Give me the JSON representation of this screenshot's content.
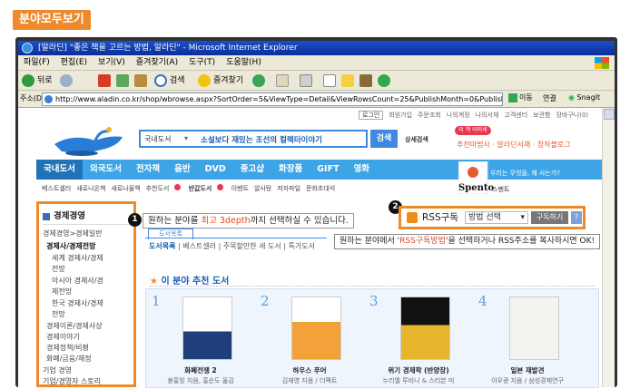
{
  "badge": "분야모두보기",
  "window": {
    "title": "[알라딘] \"좋은 책을 고르는 방법, 알라딘\" - Microsoft Internet Explorer"
  },
  "menubar": [
    "파일(F)",
    "편집(E)",
    "보기(V)",
    "즐겨찾기(A)",
    "도구(T)",
    "도움말(H)"
  ],
  "toolbar": {
    "back": "뒤로",
    "search": "검색",
    "favorites": "즐겨찾기"
  },
  "address": {
    "label": "주소(D)",
    "url": "http://www.aladin.co.kr/shop/wbrowse.aspx?SortOrder=5&ViewType=Detail&ViewRowsCount=25&PublishMonth=0&Publish",
    "go": "이동",
    "links": "연결",
    "snagit": "SnagIt"
  },
  "toplinks": [
    "로그인",
    "회원가입",
    "주문조회",
    "나의계정",
    "나의서재",
    "고객센터",
    "보관함",
    "장바구니(0)"
  ],
  "search": {
    "category": "국내도서",
    "query": "소설보다 재밌는 조선의 컬렉터이야기",
    "button": "검색",
    "detail": "상세검색"
  },
  "promo": {
    "badge": "이 책 어떠세요?",
    "text": "추천마법사 · 알라딘서재 · 창작블로그"
  },
  "nav": [
    "국내도서",
    "외국도서",
    "전자책",
    "음반",
    "DVD",
    "중고샵",
    "화장품",
    "GIFT",
    "영화"
  ],
  "subnav": [
    "베스트셀러",
    "새로나온책",
    "새로나올책",
    "추천도서",
    "반값도서",
    "이벤트",
    "알사탕",
    "저자파일",
    "문화초대석"
  ],
  "spento": {
    "brand": "Spento",
    "tagline": "우리는 무엇을, 왜 사는가?",
    "sub": "스펜트"
  },
  "sidebar": {
    "heading": "경제경영",
    "items": [
      "경제경영>경제일반",
      "경제사/경제전망",
      "세계 경제사/경제",
      "전망",
      "아시아 경제사/경",
      "제전망",
      "한국 경제사/경제",
      "전망",
      "경제이론/경제사상",
      "경제이야기",
      "경제정책/비평",
      "화폐/금융/재정",
      "기업 경영",
      "기업/경영자 스토리"
    ]
  },
  "callout1": {
    "num": "1",
    "text_a": "원하는 분야를 ",
    "text_hl": "최고 3depth",
    "text_b": "까지 선택하실 수 있습니다."
  },
  "callout2": {
    "num": "2",
    "text_a": "원하는 분야에서 '",
    "text_hl": "RSS구독방법",
    "text_b": "'을 선택하거나 RSS주소를 복사하시면 OK!"
  },
  "rss": {
    "label": "RSS구독",
    "select": "방법 선택",
    "subscribe": "구독하기",
    "help": "?"
  },
  "content": {
    "tab": "도서목록",
    "menu": [
      "도서목록",
      "베스트셀러",
      "주목할만한 새 도서",
      "특가도서"
    ],
    "rec_heading": "이 분야 추천 도서"
  },
  "books": [
    {
      "n": "1",
      "title": "화폐전쟁 2",
      "author": "쑹훙빙 지음, 홍순도 옮김"
    },
    {
      "n": "2",
      "title": "하우스 푸어",
      "author": "김재영 지음 / 더팩트"
    },
    {
      "n": "3",
      "title": "위기 경제학 (반양장)",
      "author": "누리엘 루비니 & 스티븐 미"
    },
    {
      "n": "4",
      "title": "일본 재발견",
      "author": "이우광 지음 / 삼성경제연구"
    }
  ],
  "colors": {
    "accent": "#ee8a2b",
    "nav": "#3da5e6",
    "link": "#1c5fb5",
    "highlight": "#e04a26"
  }
}
